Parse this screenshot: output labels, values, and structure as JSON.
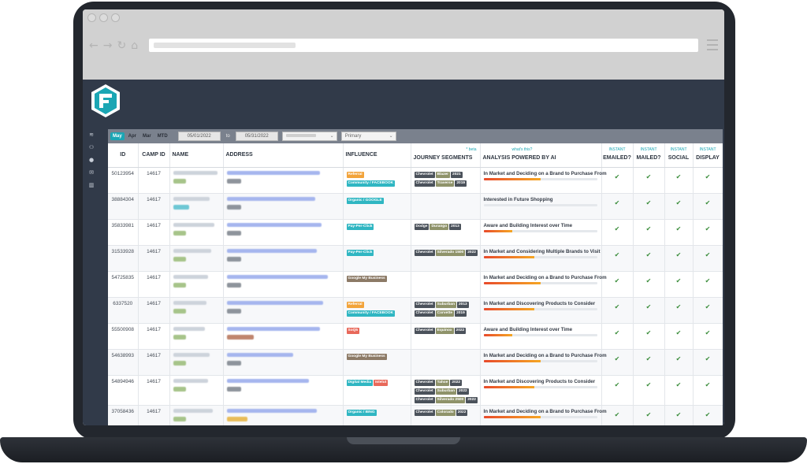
{
  "app": {
    "filters": {
      "months": [
        "May",
        "Apr",
        "Mar",
        "MTD"
      ],
      "active_month": "May",
      "date_from": "05/01/2022",
      "date_to_label": "to",
      "date_to": "05/31/2022",
      "select_primary": "Primary"
    },
    "table": {
      "headers": {
        "id": "ID",
        "camp_id": "CAMP ID",
        "name": "NAME",
        "address": "ADDRESS",
        "influence": "INFLUENCE",
        "journey_segments": "JOURNEY SEGMENTS",
        "journey_note": "* beta",
        "analysis": "ANALYSIS POWERED BY AI",
        "analysis_note": "what's this?",
        "instant_label": "INSTANT",
        "emailed": "EMAILED?",
        "mailed": "MAILED?",
        "social": "SOCIAL",
        "display": "DISPLAY"
      },
      "rows": [
        {
          "id": "50123954",
          "camp_id": "14617",
          "influence": [
            {
              "label": "Referral",
              "color": "orange"
            },
            {
              "label": "Community / FACEBOOK",
              "color": "teal"
            }
          ],
          "journey": [
            [
              "Chevrolet",
              "Blazer",
              "2021"
            ],
            [
              "Chevrolet",
              "Traverse",
              "2019"
            ]
          ],
          "analysis": "In Market and Deciding on a Brand to Purchase From",
          "score": 0.5,
          "name_chip": "green",
          "addr_chip": "gray"
        },
        {
          "id": "38884304",
          "camp_id": "14617",
          "influence": [
            {
              "label": "Organic / GOOGLE",
              "color": "teal"
            }
          ],
          "journey": [],
          "analysis": "Interested in Future Shopping",
          "score": 0.0,
          "name_chip": "teal",
          "addr_chip": "gray"
        },
        {
          "id": "35833981",
          "camp_id": "14617",
          "influence": [
            {
              "label": "Pay-Per-Click",
              "color": "teal"
            }
          ],
          "journey": [
            [
              "Dodge",
              "Durango",
              "2013"
            ]
          ],
          "analysis": "Aware and Building Interest over Time",
          "score": 0.25,
          "name_chip": "green",
          "addr_chip": "gray"
        },
        {
          "id": "31533928",
          "camp_id": "14617",
          "influence": [
            {
              "label": "Pay-Per-Click",
              "color": "teal"
            }
          ],
          "journey": [
            [
              "Chevrolet",
              "Silverado 1500",
              "2022"
            ]
          ],
          "analysis": "In Market and Considering Multiple Brands to Visit",
          "score": 0.45,
          "name_chip": "green",
          "addr_chip": "gray"
        },
        {
          "id": "54725835",
          "camp_id": "14617",
          "influence": [
            {
              "label": "Google My Business",
              "color": "brown"
            }
          ],
          "journey": [],
          "analysis": "In Market and Deciding on a Brand to Purchase From",
          "score": 0.5,
          "name_chip": "green",
          "addr_chip": "gray"
        },
        {
          "id": "6337520",
          "camp_id": "14617",
          "influence": [
            {
              "label": "Referral",
              "color": "orange"
            },
            {
              "label": "Community / FACEBOOK",
              "color": "teal"
            }
          ],
          "journey": [
            [
              "Chevrolet",
              "Suburban",
              "2013"
            ],
            [
              "Chevrolet",
              "Corvette",
              "2019"
            ]
          ],
          "analysis": "In Market and Discovering Products to Consider",
          "score": 0.45,
          "name_chip": "green",
          "addr_chip": "gray"
        },
        {
          "id": "55500908",
          "camp_id": "14617",
          "influence": [
            {
              "label": "SoQ5",
              "color": "red"
            }
          ],
          "journey": [
            [
              "Chevrolet",
              "Equinox",
              "2022"
            ]
          ],
          "analysis": "Aware and Building Interest over Time",
          "score": 0.25,
          "name_chip": "green",
          "addr_chip": "rose"
        },
        {
          "id": "54638993",
          "camp_id": "14617",
          "influence": [
            {
              "label": "Google My Business",
              "color": "brown"
            }
          ],
          "journey": [],
          "analysis": "In Market and Deciding on a Brand to Purchase From",
          "score": 0.5,
          "name_chip": "green",
          "addr_chip": "gray"
        },
        {
          "id": "54894946",
          "camp_id": "14617",
          "influence": [
            {
              "label": "Digital Media",
              "color": "teal"
            },
            {
              "label": "Istelut",
              "color": "red"
            }
          ],
          "journey": [
            [
              "Chevrolet",
              "Tahoe",
              "2022"
            ],
            [
              "Chevrolet",
              "Suburban",
              "2022"
            ],
            [
              "Chevrolet",
              "Silverado 2500",
              "2022"
            ]
          ],
          "analysis": "In Market and Discovering Products to Consider",
          "score": 0.45,
          "name_chip": "green",
          "addr_chip": "gray"
        },
        {
          "id": "37058436",
          "camp_id": "14617",
          "influence": [
            {
              "label": "Organic / BING",
              "color": "teal"
            }
          ],
          "journey": [
            [
              "Chevrolet",
              "Colorado",
              "2022"
            ]
          ],
          "analysis": "In Market and Deciding on a Brand to Purchase From",
          "score": 0.5,
          "name_chip": "green",
          "addr_chip": "gold"
        }
      ]
    }
  },
  "colors": {
    "header_bg": "#313a49",
    "accent": "#1ba6b4",
    "check": "#3b8d3b"
  }
}
